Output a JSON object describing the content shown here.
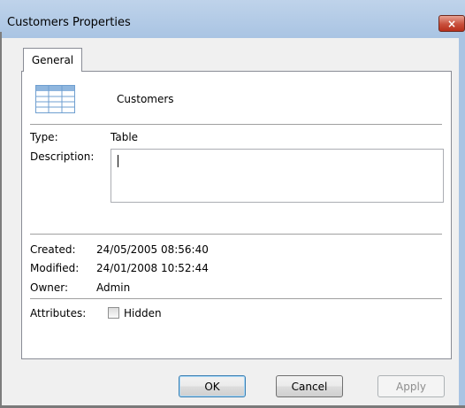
{
  "window": {
    "title": "Customers Properties",
    "close_label": "×"
  },
  "tabs": [
    {
      "label": "General"
    }
  ],
  "object": {
    "icon": "table-icon",
    "name": "Customers"
  },
  "fields": {
    "type_label": "Type:",
    "type_value": "Table",
    "description_label": "Description:",
    "description_value": "",
    "created_label": "Created:",
    "created_value": "24/05/2005 08:56:40",
    "modified_label": "Modified:",
    "modified_value": "24/01/2008 10:52:44",
    "owner_label": "Owner:",
    "owner_value": "Admin",
    "attributes_label": "Attributes:",
    "hidden_label": "Hidden",
    "hidden_checked": false
  },
  "buttons": {
    "ok": "OK",
    "cancel": "Cancel",
    "apply": "Apply"
  },
  "colors": {
    "title_bar": "#a9c4e3",
    "close_button": "#c8503c",
    "default_button_border": "#3c7fb1"
  }
}
